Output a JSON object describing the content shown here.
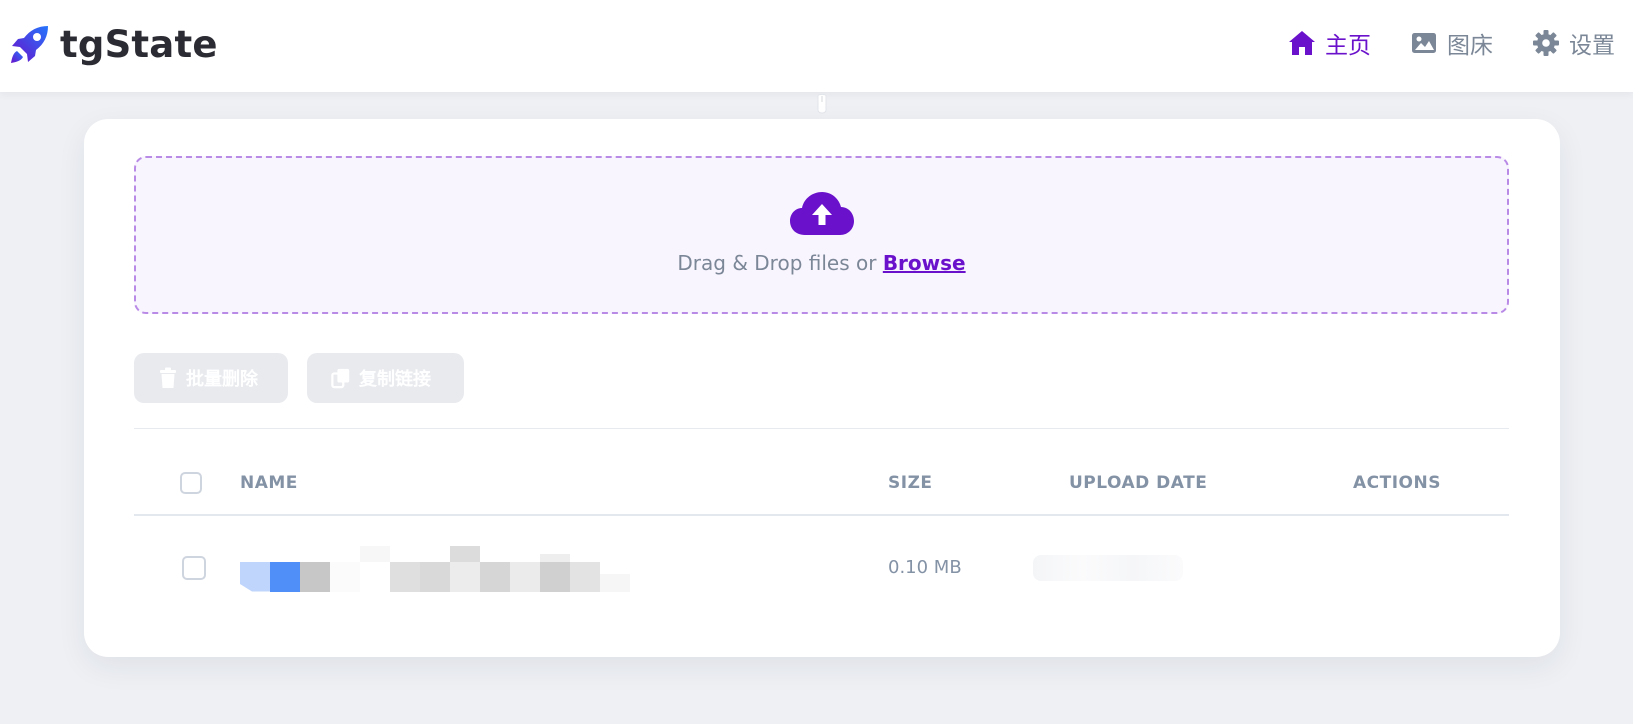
{
  "app": {
    "brand_name": "tgState"
  },
  "nav": {
    "items": [
      {
        "label": "主页",
        "icon": "home-icon",
        "active": true
      },
      {
        "label": "图床",
        "icon": "image-icon",
        "active": false
      },
      {
        "label": "设置",
        "icon": "gear-icon",
        "active": false
      }
    ]
  },
  "upload": {
    "prompt": "Drag & Drop files or",
    "browse_label": "Browse",
    "icon": "cloud-upload-icon"
  },
  "toolbar": {
    "bulk_delete_label": "批量删除",
    "copy_links_label": "复制链接"
  },
  "table": {
    "headers": {
      "name": "NAME",
      "size": "SIZE",
      "upload_date": "UPLOAD DATE",
      "actions": "ACTIONS"
    },
    "rows": [
      {
        "name": "",
        "size": "0.10 MB",
        "upload_date": ""
      }
    ]
  },
  "colors": {
    "accent": "#6a11cb",
    "muted": "#7b8797",
    "page_bg": "#eef0f4",
    "disabled_button": "#e8eaee"
  }
}
